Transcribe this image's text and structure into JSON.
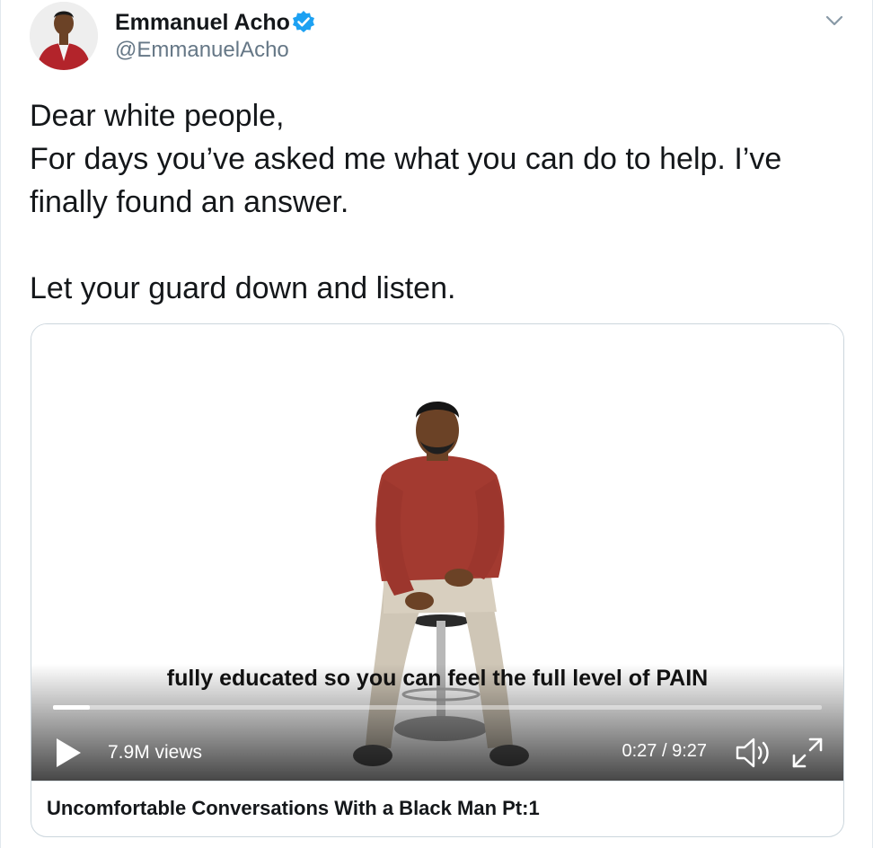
{
  "tweet": {
    "author_name": "Emmanuel Acho",
    "handle": "@EmmanuelAcho",
    "verified": true,
    "text_lines": [
      "Dear white people,",
      "For days you’ve asked me what you can do to help. I’ve finally found an answer.",
      "Let your guard down and listen."
    ]
  },
  "video": {
    "subtitle": "fully educated so you can feel the full level of PAIN",
    "views": "7.9M views",
    "time": "0:27 / 9:27",
    "progress_fraction": 0.048,
    "title": "Uncomfortable Conversations With a Black Man Pt:1"
  },
  "icons": {
    "verified": "verified-badge-icon",
    "caret": "chevron-down-icon",
    "play": "play-icon",
    "volume": "volume-icon",
    "fullscreen": "fullscreen-icon"
  },
  "colors": {
    "verified_blue": "#1da1f2",
    "handle_gray": "#657786",
    "shirt_red": "#a33a30"
  }
}
